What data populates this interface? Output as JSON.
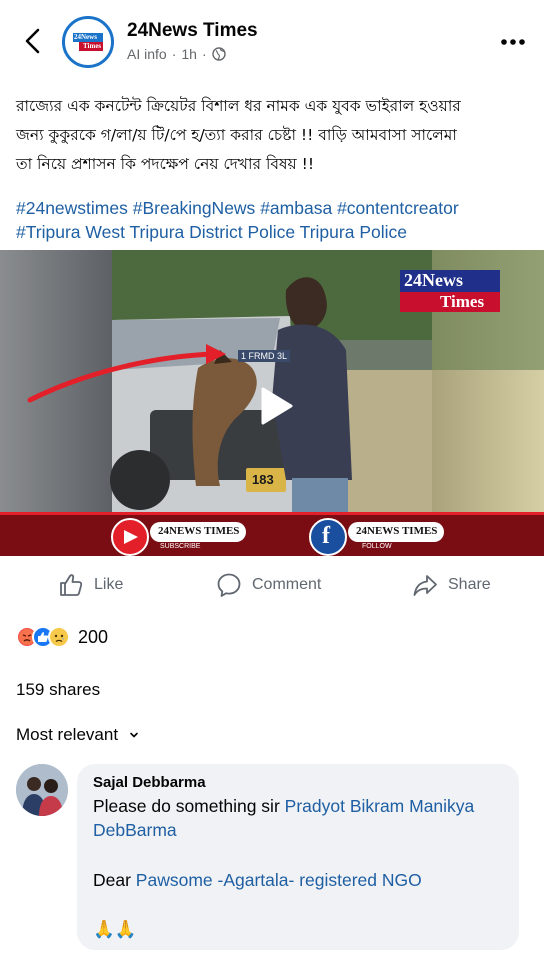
{
  "header": {
    "page_name": "24News Times",
    "meta_source": "AI info",
    "meta_sep": "·",
    "meta_time": "1h",
    "meta_sep2": "·",
    "logo_line1": "24News",
    "logo_line2": "Times"
  },
  "post": {
    "text_line1": "রাজ্যের এক কনটেন্ট ক্রিয়েটর বিশাল ধর নামক এক যুবক ভাইরাল হওয়ার",
    "text_line2": "জন্য  কুকুরকে গ/লা/য় টি/পে  হ/ত্যা করার চেষ্টা !! বাড়ি আমবাসা সালেমা",
    "text_line3": "তা নিয়ে প্রশাসন কি পদক্ষেপ নেয় দেখার বিষয় !!",
    "hashtags": [
      "#24newstimes",
      "#BreakingNews",
      "#ambasa",
      "#contentcreator"
    ],
    "tags_line2": [
      "#Tripura",
      "West Tripura District Police",
      "Tripura Police"
    ]
  },
  "video": {
    "watermark_line1": "24News",
    "watermark_line2": "Times",
    "banner_left": "24NEWS TIMES",
    "banner_left_sub": "SUBSCRIBE",
    "banner_right": "24NEWS TIMES",
    "banner_right_sub": "FOLLOW",
    "plate_text": "1 FRMD 3L",
    "plate_num": "183"
  },
  "actions": {
    "like": "Like",
    "comment": "Comment",
    "share": "Share"
  },
  "engagement": {
    "reaction_count": "200",
    "shares": "159 shares",
    "sort": "Most relevant"
  },
  "comment": {
    "name": "Sajal Debbarma",
    "line1_text": "Please do something sir ",
    "line1_link": "Pradyot Bikram Manikya",
    "line2_link": "DebBarma",
    "line3_text": "Dear ",
    "line3_link": "Pawsome -Agartala- registered NGO",
    "emoji": "🙏🙏"
  },
  "colors": {
    "link": "#1f5fa3",
    "meta_gray": "#65676b",
    "comment_bg": "#f0f2f5",
    "brand_red": "#c8102e",
    "brand_blue": "#1a73c9"
  }
}
